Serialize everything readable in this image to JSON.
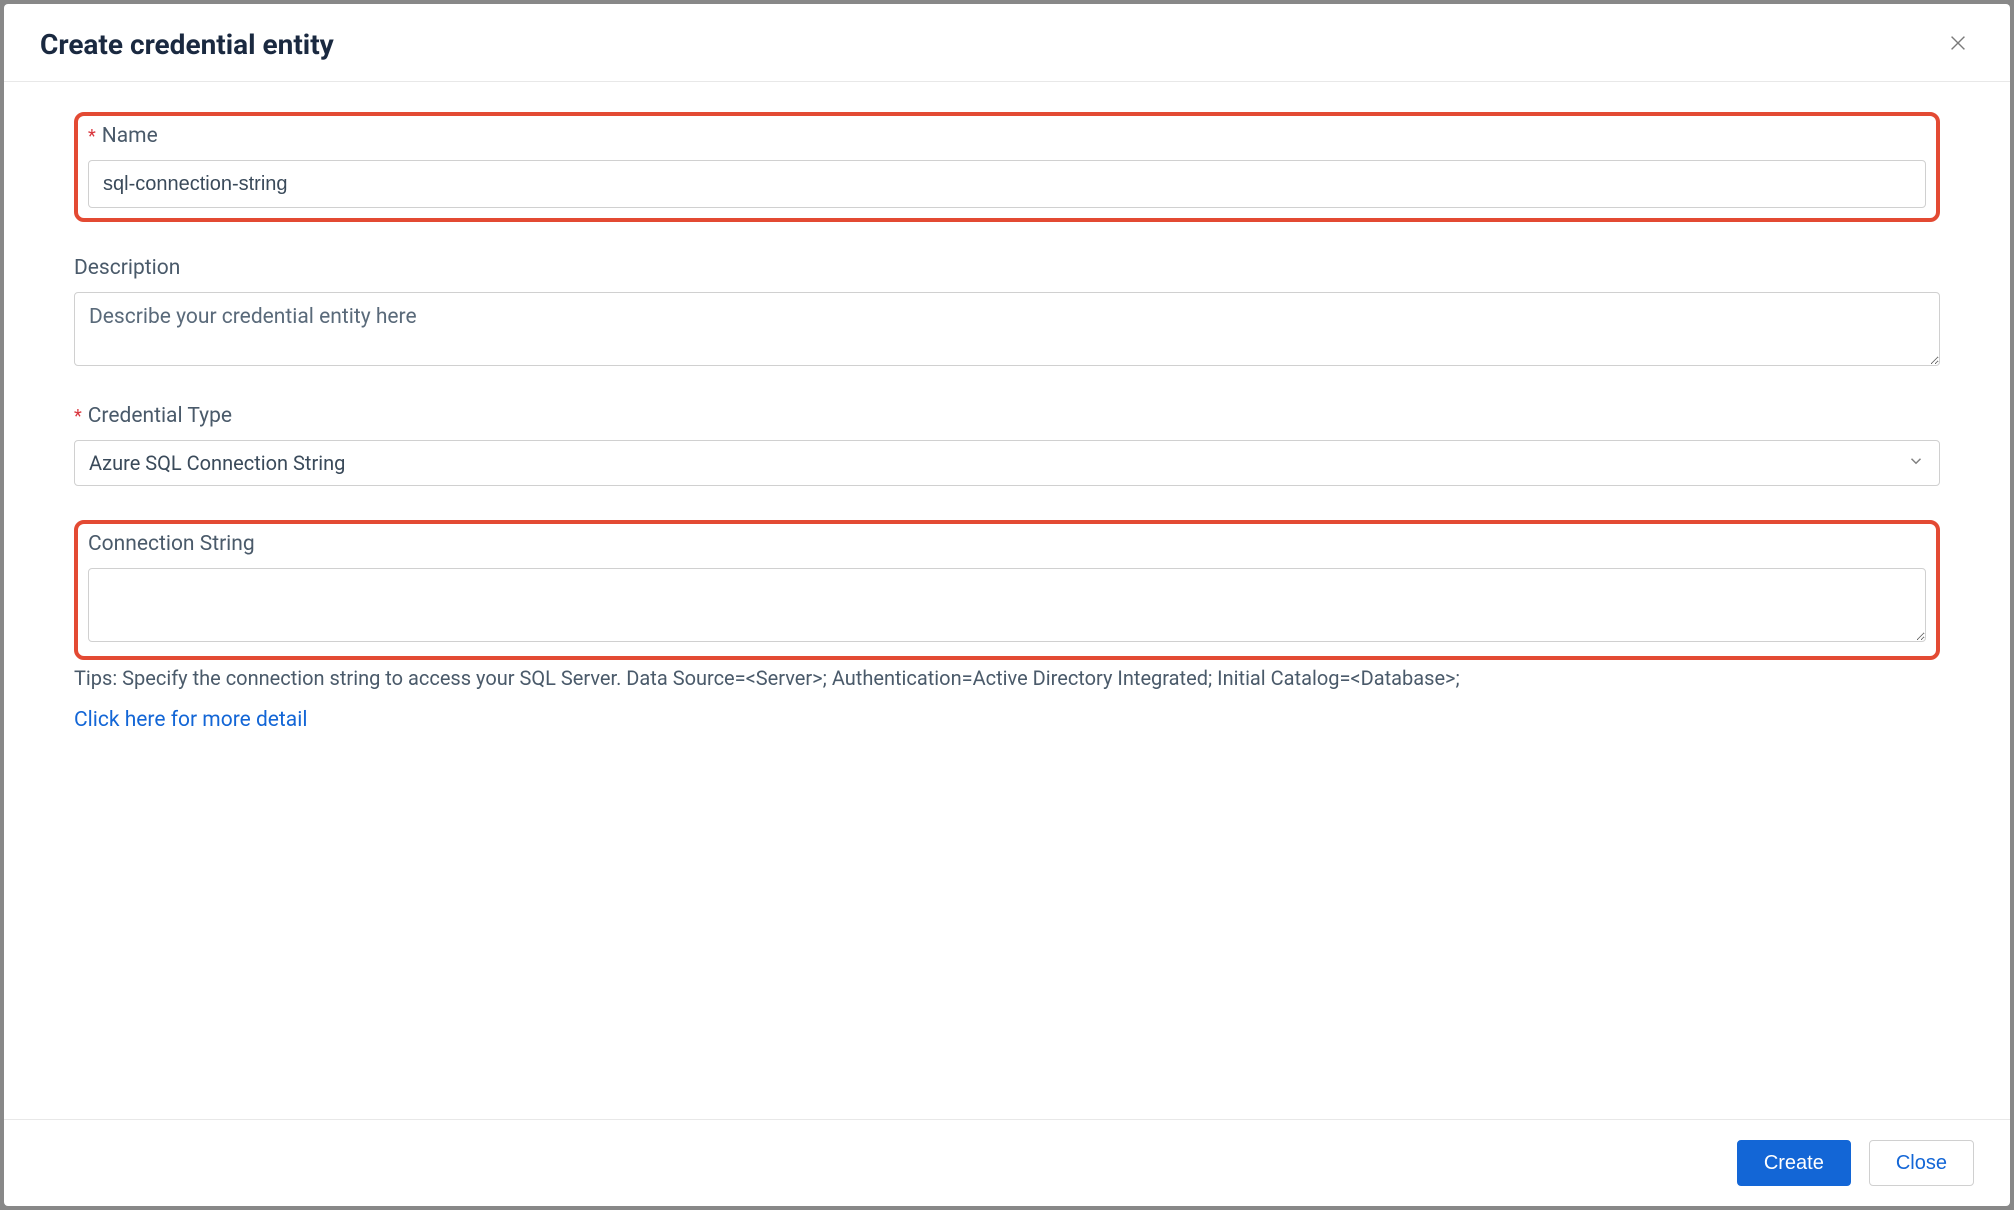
{
  "modal": {
    "title": "Create credential entity",
    "close_aria": "Close"
  },
  "fields": {
    "name": {
      "label": "Name",
      "value": "sql-connection-string"
    },
    "description": {
      "label": "Description",
      "placeholder": "Describe your credential entity here",
      "value": ""
    },
    "credential_type": {
      "label": "Credential Type",
      "selected": "Azure SQL Connection String"
    },
    "connection_string": {
      "label": "Connection String",
      "value": ""
    }
  },
  "tips": "Tips: Specify the connection string to access your SQL Server. Data Source=<Server>; Authentication=Active Directory Integrated; Initial Catalog=<Database>;",
  "link": "Click here for more detail",
  "footer": {
    "create": "Create",
    "close": "Close"
  }
}
